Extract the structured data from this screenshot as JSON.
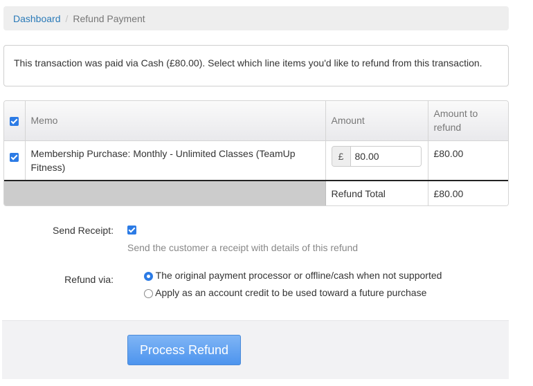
{
  "breadcrumb": {
    "items": [
      {
        "label": "Dashboard",
        "link": true
      },
      {
        "label": "Refund Payment",
        "link": false
      }
    ],
    "separator": "/"
  },
  "notice": {
    "text": "This transaction was paid via Cash (£80.00). Select which line items you'd like to refund from this transaction."
  },
  "table": {
    "select_all_checked": true,
    "headers": {
      "memo": "Memo",
      "amount": "Amount",
      "amount_to_refund": "Amount to refund"
    },
    "rows": [
      {
        "checked": true,
        "memo": "Membership Purchase: Monthly - Unlimited Classes (TeamUp Fitness)",
        "currency_symbol": "£",
        "amount_value": "80.00",
        "amount_to_refund": "£80.00"
      }
    ],
    "total": {
      "label": "Refund Total",
      "value": "£80.00"
    }
  },
  "send_receipt": {
    "label": "Send Receipt:",
    "checked": true,
    "help": "Send the customer a receipt with details of this refund"
  },
  "refund_via": {
    "label": "Refund via:",
    "options": [
      {
        "label": "The original payment processor or offline/cash when not supported",
        "selected": true
      },
      {
        "label": "Apply as an account credit to be used toward a future purchase",
        "selected": false
      }
    ]
  },
  "actions": {
    "process_refund_label": "Process Refund"
  },
  "colors": {
    "link": "#2a7ab8",
    "accent": "#2c7be5",
    "button": "#5a9cf0"
  }
}
